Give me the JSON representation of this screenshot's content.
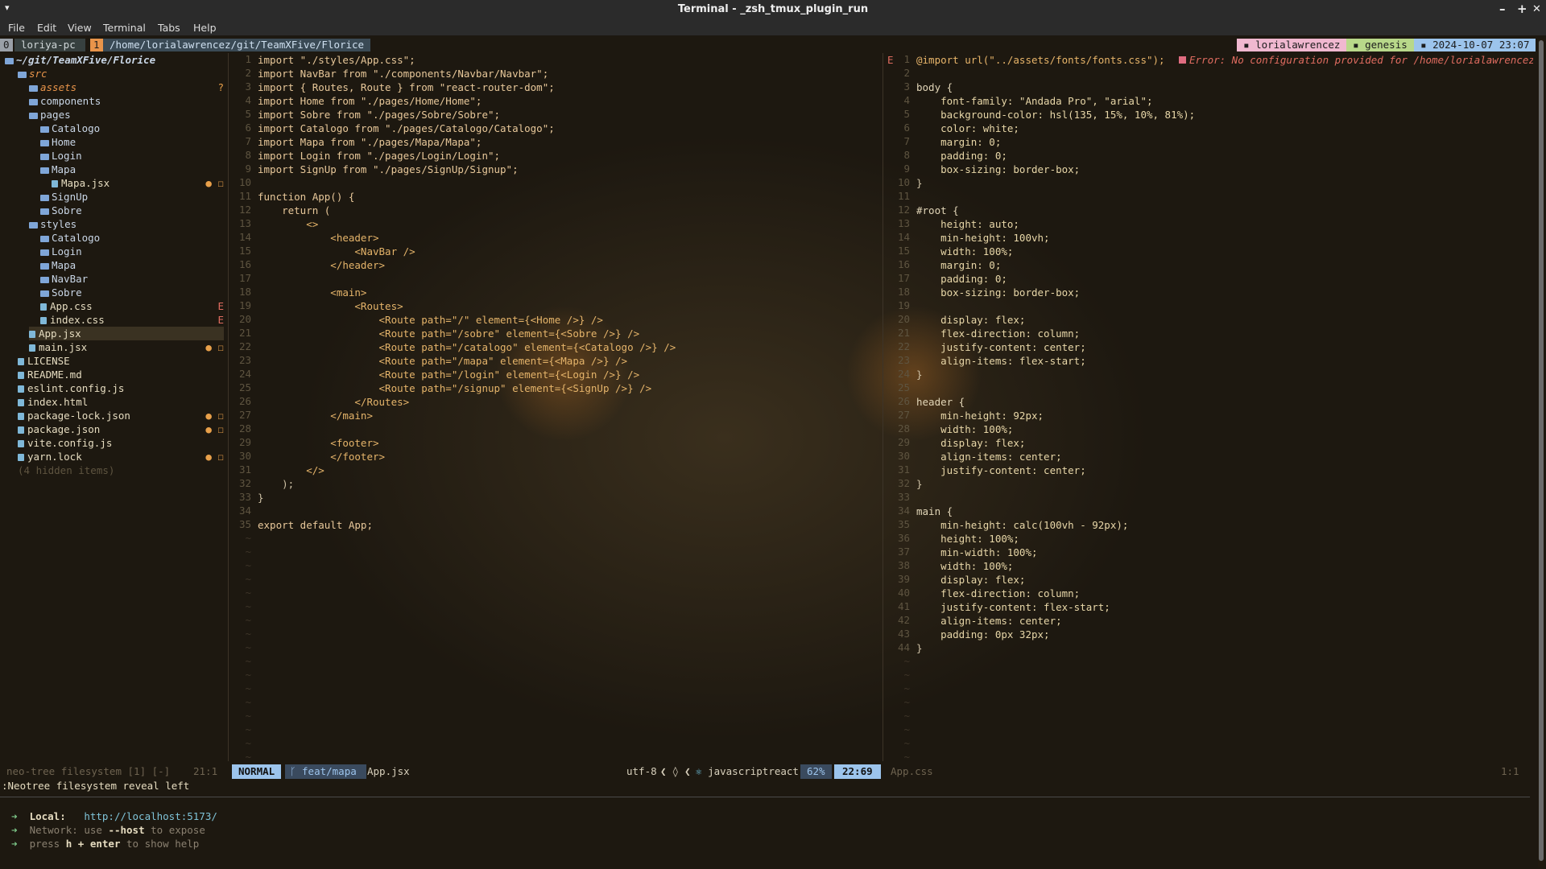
{
  "window": {
    "title": "Terminal - _zsh_tmux_plugin_run",
    "min": "–",
    "max": "+",
    "close": "✕",
    "menu_arrow": "▾"
  },
  "menu": [
    "File",
    "Edit",
    "View",
    "Terminal",
    "Tabs",
    "Help"
  ],
  "tmux": {
    "win0_num": "0",
    "win0_name": "loriya-pc",
    "win1_num": "1",
    "win1_path": "/home/lorialawrencez/git/TeamXFive/Florice",
    "user": "lorialawrencez",
    "session": "genesis",
    "datetime": "2024-10-07 23:07"
  },
  "tree": {
    "root": "~/git/TeamXFive/Florice",
    "items": [
      {
        "label": "src",
        "indent": 1,
        "type": "dir",
        "it": true
      },
      {
        "label": "assets",
        "indent": 2,
        "type": "dir",
        "it": true,
        "mark": "?"
      },
      {
        "label": "components",
        "indent": 2,
        "type": "dir"
      },
      {
        "label": "pages",
        "indent": 2,
        "type": "dir"
      },
      {
        "label": "Catalogo",
        "indent": 3,
        "type": "dir"
      },
      {
        "label": "Home",
        "indent": 3,
        "type": "dir"
      },
      {
        "label": "Login",
        "indent": 3,
        "type": "dir"
      },
      {
        "label": "Mapa",
        "indent": 3,
        "type": "dir"
      },
      {
        "label": "Mapa.jsx",
        "indent": 4,
        "type": "file",
        "mark": "● ☐"
      },
      {
        "label": "SignUp",
        "indent": 3,
        "type": "dir"
      },
      {
        "label": "Sobre",
        "indent": 3,
        "type": "dir"
      },
      {
        "label": "styles",
        "indent": 2,
        "type": "dir"
      },
      {
        "label": "Catalogo",
        "indent": 3,
        "type": "dir"
      },
      {
        "label": "Login",
        "indent": 3,
        "type": "dir"
      },
      {
        "label": "Mapa",
        "indent": 3,
        "type": "dir"
      },
      {
        "label": "NavBar",
        "indent": 3,
        "type": "dir"
      },
      {
        "label": "Sobre",
        "indent": 3,
        "type": "dir"
      },
      {
        "label": "App.css",
        "indent": 3,
        "type": "file",
        "mark": "E"
      },
      {
        "label": "index.css",
        "indent": 3,
        "type": "file",
        "mark": "E"
      },
      {
        "label": "App.jsx",
        "indent": 2,
        "type": "file",
        "selected": true
      },
      {
        "label": "main.jsx",
        "indent": 2,
        "type": "file",
        "mark": "● ☐"
      },
      {
        "label": "LICENSE",
        "indent": 1,
        "type": "file"
      },
      {
        "label": "README.md",
        "indent": 1,
        "type": "file"
      },
      {
        "label": "eslint.config.js",
        "indent": 1,
        "type": "file"
      },
      {
        "label": "index.html",
        "indent": 1,
        "type": "file"
      },
      {
        "label": "package-lock.json",
        "indent": 1,
        "type": "file",
        "mark": "● ☐"
      },
      {
        "label": "package.json",
        "indent": 1,
        "type": "file",
        "mark": "● ☐"
      },
      {
        "label": "vite.config.js",
        "indent": 1,
        "type": "file"
      },
      {
        "label": "yarn.lock",
        "indent": 1,
        "type": "file",
        "mark": "● ☐"
      },
      {
        "label": "(4 hidden items)",
        "indent": 1,
        "type": "hidden"
      }
    ]
  },
  "left_code": [
    "import \"./styles/App.css\";",
    "import NavBar from \"./components/Navbar/Navbar\";",
    "import { Routes, Route } from \"react-router-dom\";",
    "import Home from \"./pages/Home/Home\";",
    "import Sobre from \"./pages/Sobre/Sobre\";",
    "import Catalogo from \"./pages/Catalogo/Catalogo\";",
    "import Mapa from \"./pages/Mapa/Mapa\";",
    "import Login from \"./pages/Login/Login\";",
    "import SignUp from \"./pages/SignUp/Signup\";",
    "",
    "function App() {",
    "    return (",
    "        <>",
    "            <header>",
    "                <NavBar />",
    "            </header>",
    "",
    "            <main>",
    "                <Routes>",
    "                    <Route path=\"/\" element={<Home />} />",
    "                    <Route path=\"/sobre\" element={<Sobre />} />",
    "                    <Route path=\"/catalogo\" element={<Catalogo />} />",
    "                    <Route path=\"/mapa\" element={<Mapa />} />",
    "                    <Route path=\"/login\" element={<Login />} />",
    "                    <Route path=\"/signup\" element={<SignUp />} />",
    "                </Routes>",
    "            </main>",
    "",
    "            <footer>",
    "            </footer>",
    "        </>",
    "    );",
    "}",
    "",
    "export default App;"
  ],
  "right_code": [
    "@import url(\"../assets/fonts/fonts.css\");",
    "",
    "body {",
    "    font-family: \"Andada Pro\", \"arial\";",
    "    background-color: hsl(135, 15%, 10%, 81%);",
    "    color: white;",
    "    margin: 0;",
    "    padding: 0;",
    "    box-sizing: border-box;",
    "}",
    "",
    "#root {",
    "    height: auto;",
    "    min-height: 100vh;",
    "    width: 100%;",
    "    margin: 0;",
    "    padding: 0;",
    "    box-sizing: border-box;",
    "",
    "    display: flex;",
    "    flex-direction: column;",
    "    justify-content: center;",
    "    align-items: flex-start;",
    "}",
    "",
    "header {",
    "    min-height: 92px;",
    "    width: 100%;",
    "    display: flex;",
    "    align-items: center;",
    "    justify-content: center;",
    "}",
    "",
    "main {",
    "    min-height: calc(100vh - 92px);",
    "    height: 100%;",
    "    min-width: 100%;",
    "    width: 100%;",
    "    display: flex;",
    "    flex-direction: column;",
    "    justify-content: flex-start;",
    "    align-items: center;",
    "    padding: 0px 32px;",
    "}"
  ],
  "right_error_sign": "E",
  "right_error": "Error: No configuration provided for /home/lorialawrencez/gi",
  "status": {
    "tree_label": "neo-tree filesystem [1] [-]",
    "tree_pos": "21:1",
    "mode": "NORMAL",
    "branch": "feat/mapa",
    "file": "App.jsx",
    "encoding": "utf-8",
    "filetype": "javascriptreact",
    "percent": "62%",
    "position": "22:69",
    "right_file": "App.css",
    "right_pos": "1:1"
  },
  "cmdline": ":Neotree filesystem reveal left",
  "vite": {
    "local_label": "Local:",
    "local_url": "http://localhost:5173/",
    "network_label": "Network:",
    "network_pre": "use",
    "network_flag": "--host",
    "network_post": "to expose",
    "help_pre": "press",
    "help_key": "h + enter",
    "help_post": "to show help"
  }
}
